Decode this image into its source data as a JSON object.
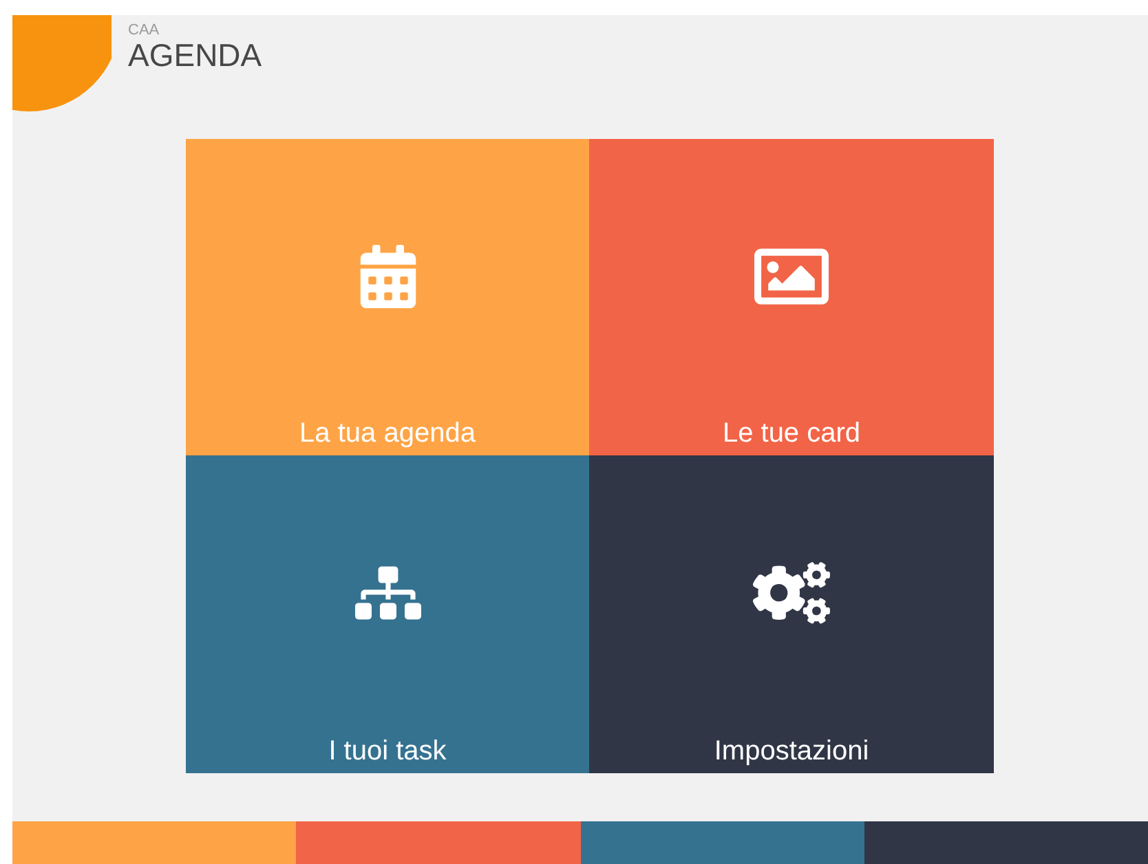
{
  "header": {
    "subtitle": "CAA",
    "title": "AGENDA"
  },
  "tiles": [
    {
      "kind": "agenda",
      "label": "La tua agenda",
      "color": "#fea446"
    },
    {
      "kind": "cards",
      "label": "Le tue card",
      "color": "#f26447"
    },
    {
      "kind": "tasks",
      "label": "I tuoi task",
      "color": "#357290"
    },
    {
      "kind": "settings",
      "label": "Impostazioni",
      "color": "#303646"
    }
  ]
}
